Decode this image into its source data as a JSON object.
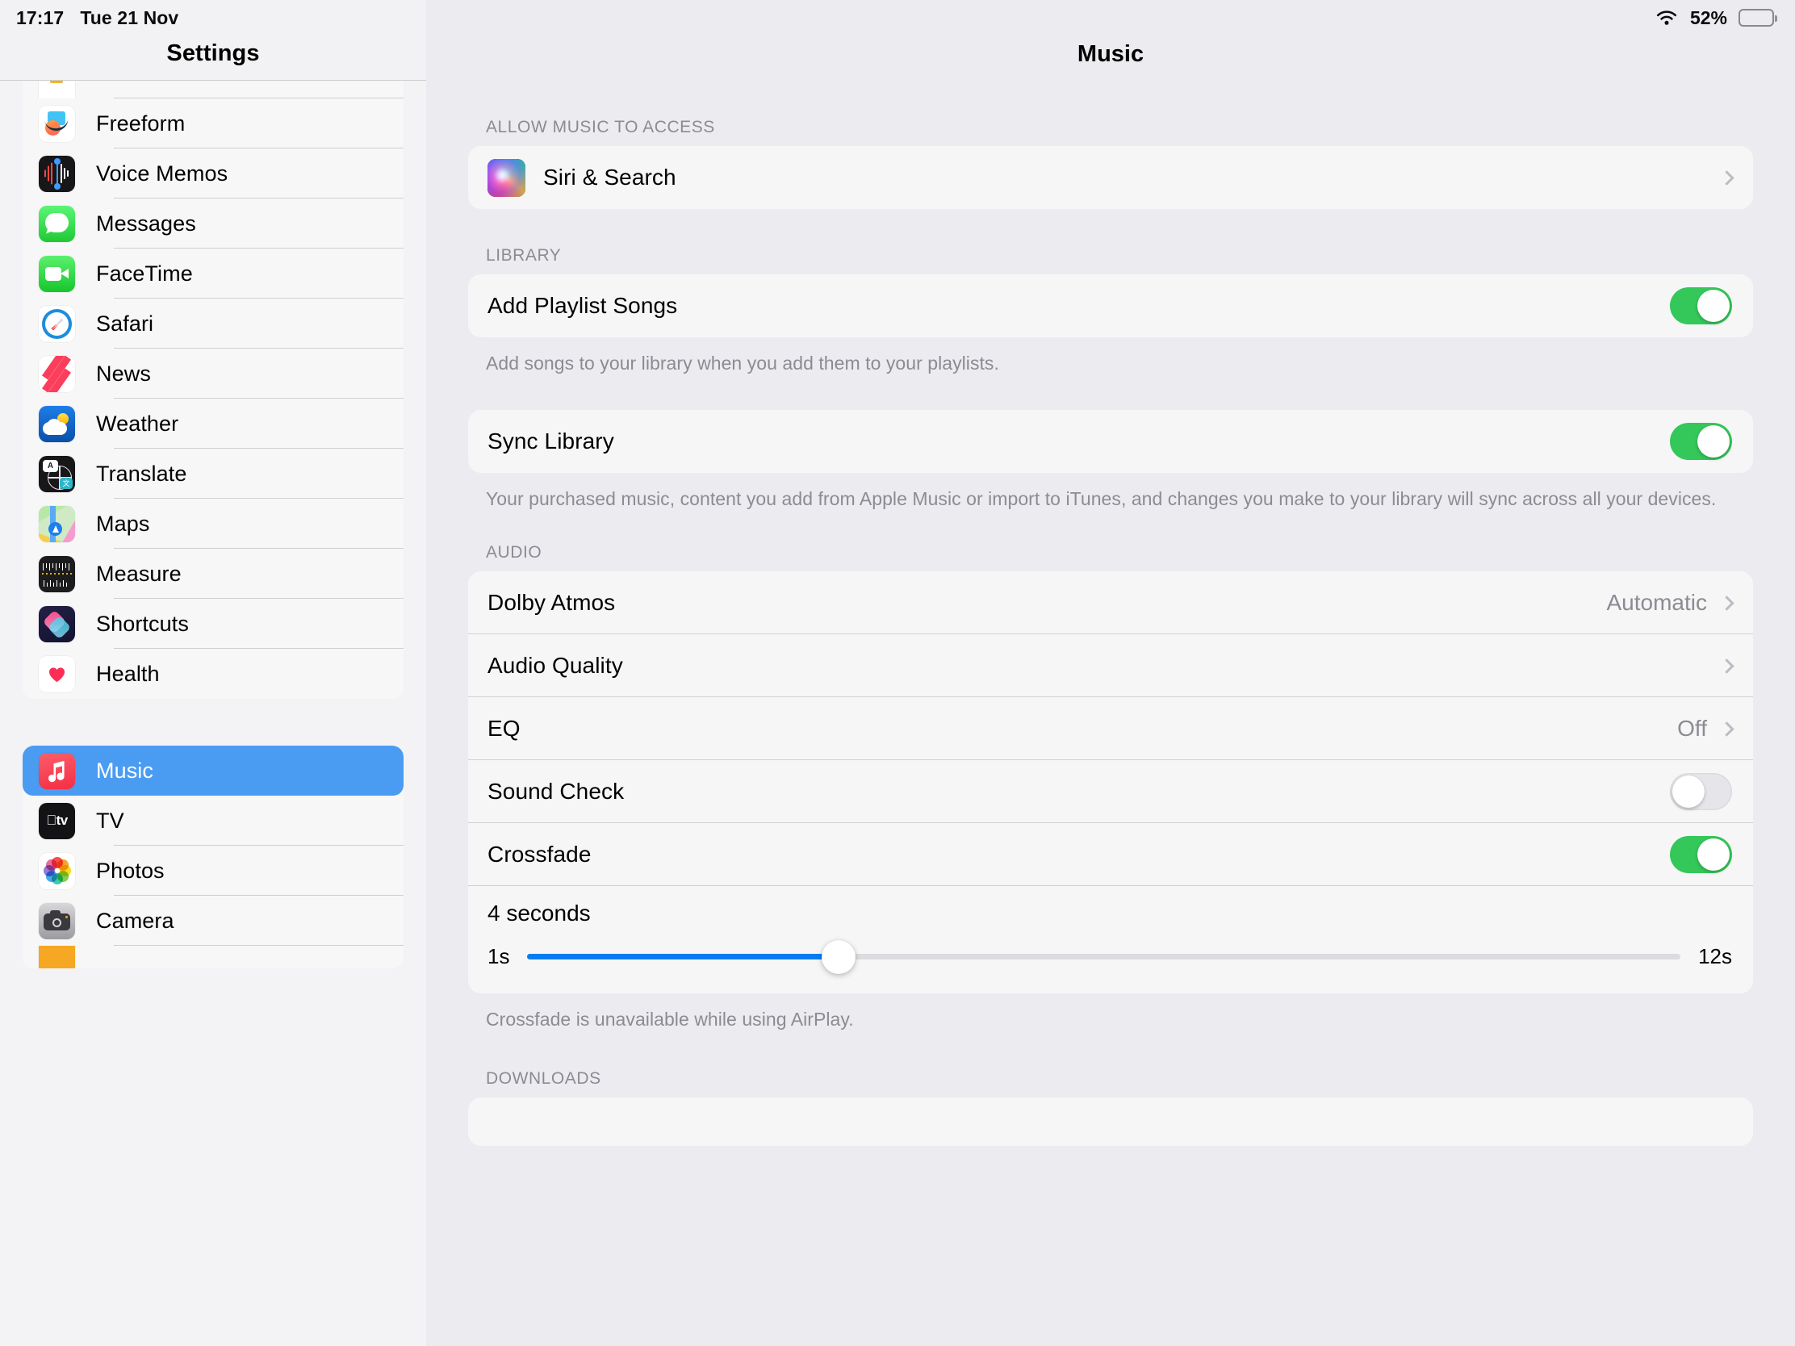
{
  "status_bar": {
    "time": "17:17",
    "date": "Tue 21 Nov",
    "wifi_icon": "wifi-icon",
    "battery_percent": "52%",
    "battery_level": 52,
    "battery_icon": "battery-icon"
  },
  "sidebar": {
    "title": "Settings",
    "groups": [
      {
        "items": [
          {
            "label": "",
            "icon": "partial-app-icon",
            "icon_class": "ic-partial",
            "partial": true
          },
          {
            "label": "Freeform",
            "icon": "freeform-app-icon",
            "icon_class": "ic-freeform"
          },
          {
            "label": "Voice Memos",
            "icon": "voice-memos-app-icon",
            "icon_class": "ic-voice"
          },
          {
            "label": "Messages",
            "icon": "messages-app-icon",
            "icon_class": "ic-msg"
          },
          {
            "label": "FaceTime",
            "icon": "facetime-app-icon",
            "icon_class": "ic-ft"
          },
          {
            "label": "Safari",
            "icon": "safari-app-icon",
            "icon_class": "ic-safari"
          },
          {
            "label": "News",
            "icon": "news-app-icon",
            "icon_class": "ic-news"
          },
          {
            "label": "Weather",
            "icon": "weather-app-icon",
            "icon_class": "ic-weather"
          },
          {
            "label": "Translate",
            "icon": "translate-app-icon",
            "icon_class": "ic-translate"
          },
          {
            "label": "Maps",
            "icon": "maps-app-icon",
            "icon_class": "ic-maps"
          },
          {
            "label": "Measure",
            "icon": "measure-app-icon",
            "icon_class": "ic-measure"
          },
          {
            "label": "Shortcuts",
            "icon": "shortcuts-app-icon",
            "icon_class": "ic-shortcuts"
          },
          {
            "label": "Health",
            "icon": "health-app-icon",
            "icon_class": "ic-health"
          }
        ]
      },
      {
        "items": [
          {
            "label": "Music",
            "icon": "music-app-icon",
            "icon_class": "ic-music",
            "selected": true
          },
          {
            "label": "TV",
            "icon": "tv-app-icon",
            "icon_class": "ic-tv"
          },
          {
            "label": "Photos",
            "icon": "photos-app-icon",
            "icon_class": "ic-photos"
          },
          {
            "label": "Camera",
            "icon": "camera-app-icon",
            "icon_class": "ic-camera"
          },
          {
            "label": "",
            "icon": "partial-orange-app-icon",
            "icon_class": "ic-orange",
            "partial": true
          }
        ]
      }
    ],
    "selected_accent": "#4a9cf2"
  },
  "detail": {
    "title": "Music",
    "sections": {
      "access": {
        "header": "ALLOW MUSIC TO ACCESS",
        "siri_label": "Siri & Search",
        "siri_icon": "siri-app-icon",
        "chevron": "chevron-right-icon"
      },
      "library": {
        "header": "LIBRARY",
        "add_playlist_songs_label": "Add Playlist Songs",
        "add_playlist_songs_on": true,
        "add_playlist_songs_footnote": "Add songs to your library when you add them to your playlists.",
        "sync_library_label": "Sync Library",
        "sync_library_on": true,
        "sync_library_footnote": "Your purchased music, content you add from Apple Music or import to iTunes, and changes you make to your library will sync across all your devices."
      },
      "audio": {
        "header": "AUDIO",
        "dolby_atmos_label": "Dolby Atmos",
        "dolby_atmos_value": "Automatic",
        "audio_quality_label": "Audio Quality",
        "eq_label": "EQ",
        "eq_value": "Off",
        "sound_check_label": "Sound Check",
        "sound_check_on": false,
        "crossfade_label": "Crossfade",
        "crossfade_on": true,
        "crossfade_seconds_label": "4 seconds",
        "crossfade_min_label": "1s",
        "crossfade_max_label": "12s",
        "crossfade_value": 4,
        "crossfade_min": 1,
        "crossfade_max": 12,
        "crossfade_fill_percent": 27,
        "footnote": "Crossfade is unavailable while using AirPlay."
      },
      "downloads": {
        "header": "DOWNLOADS"
      }
    },
    "toggle_on_color": "#34c759",
    "slider_color": "#0a7cf0"
  }
}
